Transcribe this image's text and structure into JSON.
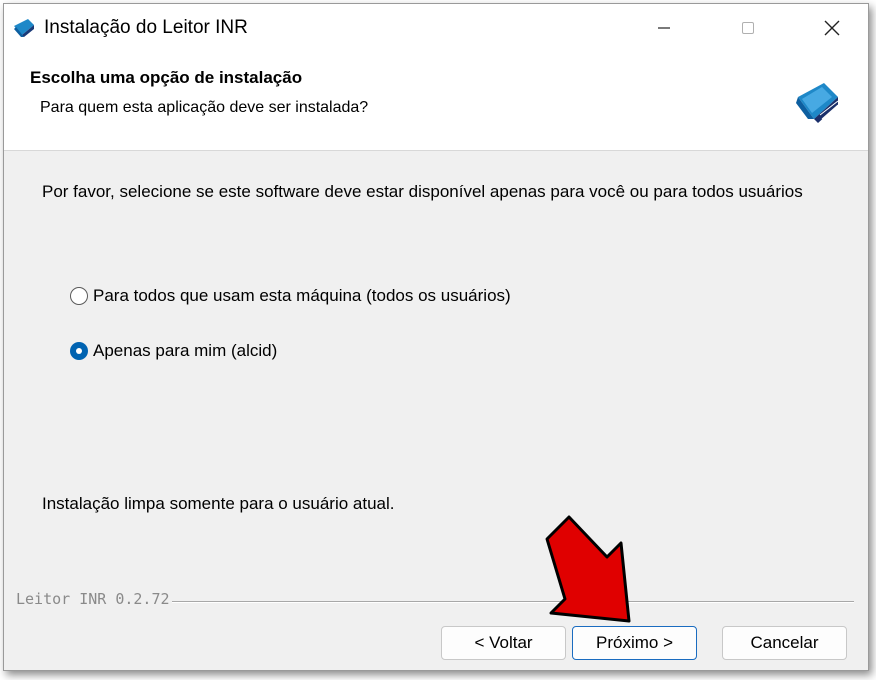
{
  "window": {
    "title": "Instalação do Leitor INR",
    "controls": [
      "minimize",
      "maximize",
      "close"
    ]
  },
  "header": {
    "title": "Escolha uma opção de instalação",
    "subtitle": "Para quem esta aplicação deve ser instalada?",
    "logo_icon": "leitor-inr-logo-icon"
  },
  "content": {
    "description": "Por favor, selecione se este software deve estar disponível apenas para você ou para todos usuários",
    "options": [
      {
        "label": "Para todos que usam esta máquina (todos os usuários)",
        "selected": false
      },
      {
        "label": "Apenas para mim (alcid)",
        "selected": true
      }
    ],
    "status": "Instalação limpa somente para o usuário atual."
  },
  "footer": {
    "brand": "Leitor INR 0.2.72",
    "back_label": "< Voltar",
    "next_label": "Próximo >",
    "cancel_label": "Cancelar"
  },
  "annotation": {
    "arrow_color": "#e00000",
    "points_to": "next-button"
  }
}
